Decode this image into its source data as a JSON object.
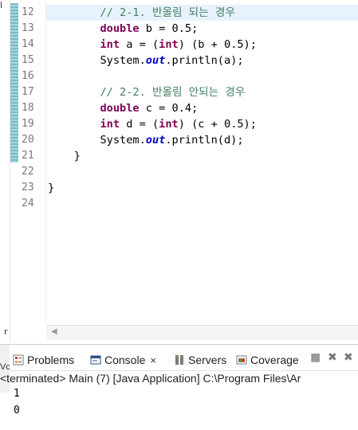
{
  "editor": {
    "line_numbers": [
      "12",
      "13",
      "14",
      "15",
      "16",
      "17",
      "18",
      "19",
      "20",
      "21",
      "22",
      "23",
      "24"
    ],
    "lines": [
      [
        {
          "t": "        "
        },
        {
          "t": "// 2-1. 반올림 되는 경우",
          "c": "cm"
        }
      ],
      [
        {
          "t": "        "
        },
        {
          "t": "double",
          "c": "kw"
        },
        {
          "t": " b = 0.5;"
        }
      ],
      [
        {
          "t": "        "
        },
        {
          "t": "int",
          "c": "kw"
        },
        {
          "t": " a = ("
        },
        {
          "t": "int",
          "c": "kw"
        },
        {
          "t": ") (b + 0.5);"
        }
      ],
      [
        {
          "t": "        System."
        },
        {
          "t": "out",
          "c": "st"
        },
        {
          "t": ".println(a);"
        }
      ],
      [
        {
          "t": ""
        }
      ],
      [
        {
          "t": "        "
        },
        {
          "t": "// 2-2. 반올림 안되는 경우",
          "c": "cm"
        }
      ],
      [
        {
          "t": "        "
        },
        {
          "t": "double",
          "c": "kw"
        },
        {
          "t": " c = 0.4;"
        }
      ],
      [
        {
          "t": "        "
        },
        {
          "t": "int",
          "c": "kw"
        },
        {
          "t": " d = ("
        },
        {
          "t": "int",
          "c": "kw"
        },
        {
          "t": ") (c + 0.5);"
        }
      ],
      [
        {
          "t": "        System."
        },
        {
          "t": "out",
          "c": "st"
        },
        {
          "t": ".println(d);"
        }
      ],
      [
        {
          "t": "    }"
        }
      ],
      [
        {
          "t": ""
        }
      ],
      [
        {
          "t": "}"
        }
      ],
      [
        {
          "t": ""
        }
      ]
    ],
    "left_strip_top": "l",
    "left_strip_mark": "r"
  },
  "panel": {
    "tabs": [
      {
        "name": "tab-problems",
        "label": "Problems",
        "icon": "problems-icon"
      },
      {
        "name": "tab-console",
        "label": "Console",
        "icon": "console-icon",
        "close": "×"
      },
      {
        "name": "tab-servers",
        "label": "Servers",
        "icon": "servers-icon"
      },
      {
        "name": "tab-coverage",
        "label": "Coverage",
        "icon": "coverage-icon"
      }
    ],
    "left_mark": "Vc",
    "status": "<terminated> Main (7) [Java Application] C:\\Program Files\\Ar",
    "output": [
      "1",
      "0"
    ]
  },
  "colors": {
    "keyword": "#7f0055",
    "comment": "#3f7f5f",
    "static_field": "#0000c0",
    "current_line": "#e8f2fe",
    "line_number": "#787878"
  }
}
